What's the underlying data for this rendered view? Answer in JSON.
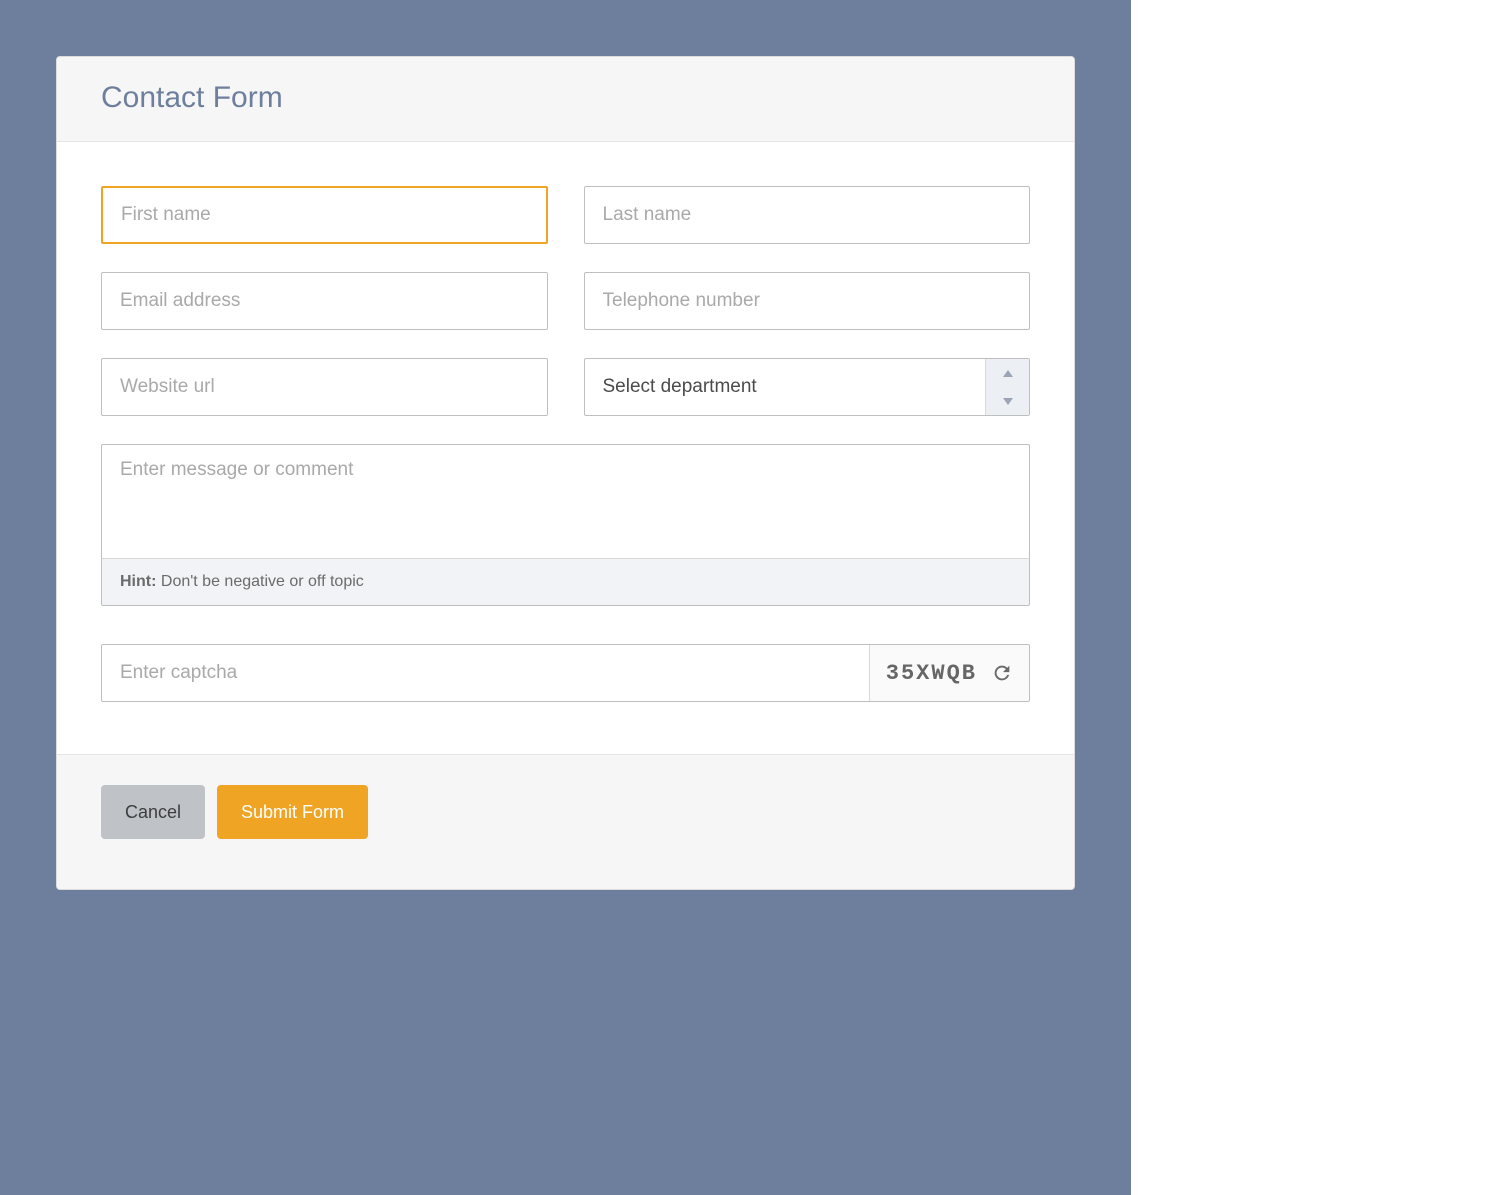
{
  "header": {
    "title": "Contact Form"
  },
  "fields": {
    "first_name": {
      "placeholder": "First name",
      "value": ""
    },
    "last_name": {
      "placeholder": "Last name",
      "value": ""
    },
    "email": {
      "placeholder": "Email address",
      "value": ""
    },
    "phone": {
      "placeholder": "Telephone number",
      "value": ""
    },
    "website": {
      "placeholder": "Website url",
      "value": ""
    },
    "department": {
      "selected_label": "Select department"
    },
    "message": {
      "placeholder": "Enter message or comment",
      "value": ""
    },
    "captcha": {
      "placeholder": "Enter captcha",
      "value": "",
      "code": "35XWQB"
    }
  },
  "hint": {
    "label": "Hint:",
    "text": " Don't be negative or off topic"
  },
  "buttons": {
    "cancel": "Cancel",
    "submit": "Submit Form"
  },
  "colors": {
    "accent": "#efa424",
    "page_bg": "#6d7f9d"
  }
}
